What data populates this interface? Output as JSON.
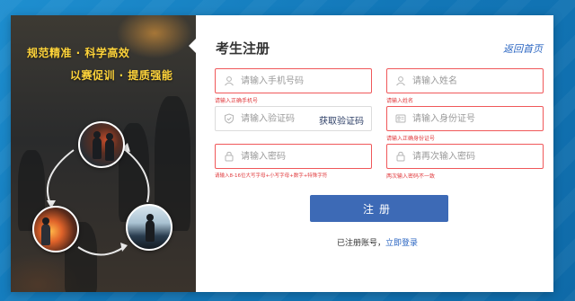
{
  "banner": {
    "slogan_line1": "规范精准 · 科学高效",
    "slogan_line2": "以赛促训 · 提质强能"
  },
  "form": {
    "title": "考生注册",
    "back_link": "返回首页",
    "phone": {
      "placeholder": "请输入手机号码",
      "error": "请输入正确手机号"
    },
    "name": {
      "placeholder": "请输入姓名",
      "error": "请输入姓名"
    },
    "code": {
      "placeholder": "请输入验证码",
      "button": "获取验证码"
    },
    "id_number": {
      "placeholder": "请输入身份证号",
      "error": "请输入正确身份证号"
    },
    "password": {
      "placeholder": "请输入密码",
      "error": "请输入8-16位大写字母+小写字母+数字+特殊字符"
    },
    "password_confirm": {
      "placeholder": "请再次输入密码",
      "error": "两次输入密码不一致"
    },
    "submit_label": "注册",
    "login_prompt": "已注册账号，",
    "login_link": "立即登录"
  },
  "colors": {
    "accent": "#3d6ab6",
    "error": "#e0393c",
    "slogan": "#ffd43a",
    "background": "#1a82c4"
  }
}
